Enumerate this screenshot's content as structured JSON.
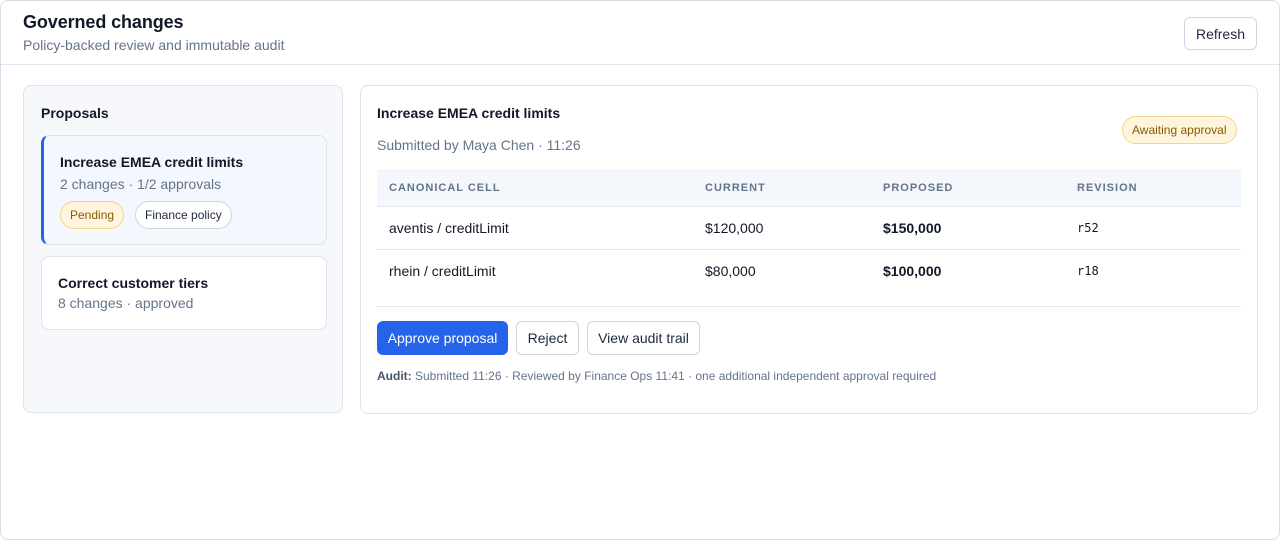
{
  "header": {
    "title": "Governed changes",
    "subtitle": "Policy-backed review and immutable audit",
    "refresh_label": "Refresh"
  },
  "proposals": {
    "title": "Proposals",
    "items": [
      {
        "title": "Increase EMEA credit limits",
        "meta": "2 changes · 1/2 approvals",
        "tags": [
          "Pending",
          "Finance policy"
        ],
        "selected": true
      },
      {
        "title": "Correct customer tiers",
        "meta": "8 changes · approved",
        "selected": false
      }
    ]
  },
  "detail": {
    "title": "Increase EMEA credit limits",
    "meta": "Submitted by Maya Chen · 11:26",
    "status": "Awaiting approval",
    "columns": [
      "Canonical cell",
      "Current",
      "Proposed",
      "Revision"
    ],
    "rows": [
      {
        "cell": "aventis / creditLimit",
        "current": "$120,000",
        "proposed": "$150,000",
        "revision": "r52"
      },
      {
        "cell": "rhein / creditLimit",
        "current": "$80,000",
        "proposed": "$100,000",
        "revision": "r18"
      }
    ],
    "actions": {
      "approve": "Approve proposal",
      "reject": "Reject",
      "audit_trail": "View audit trail"
    },
    "audit_label": "Audit:",
    "audit_text": " Submitted 11:26 · Reviewed by Finance Ops 11:41 · one additional independent approval required"
  },
  "colors": {
    "accent": "#2563eb",
    "pending_bg": "#fef5dc",
    "pending_text": "#8a5a00"
  }
}
